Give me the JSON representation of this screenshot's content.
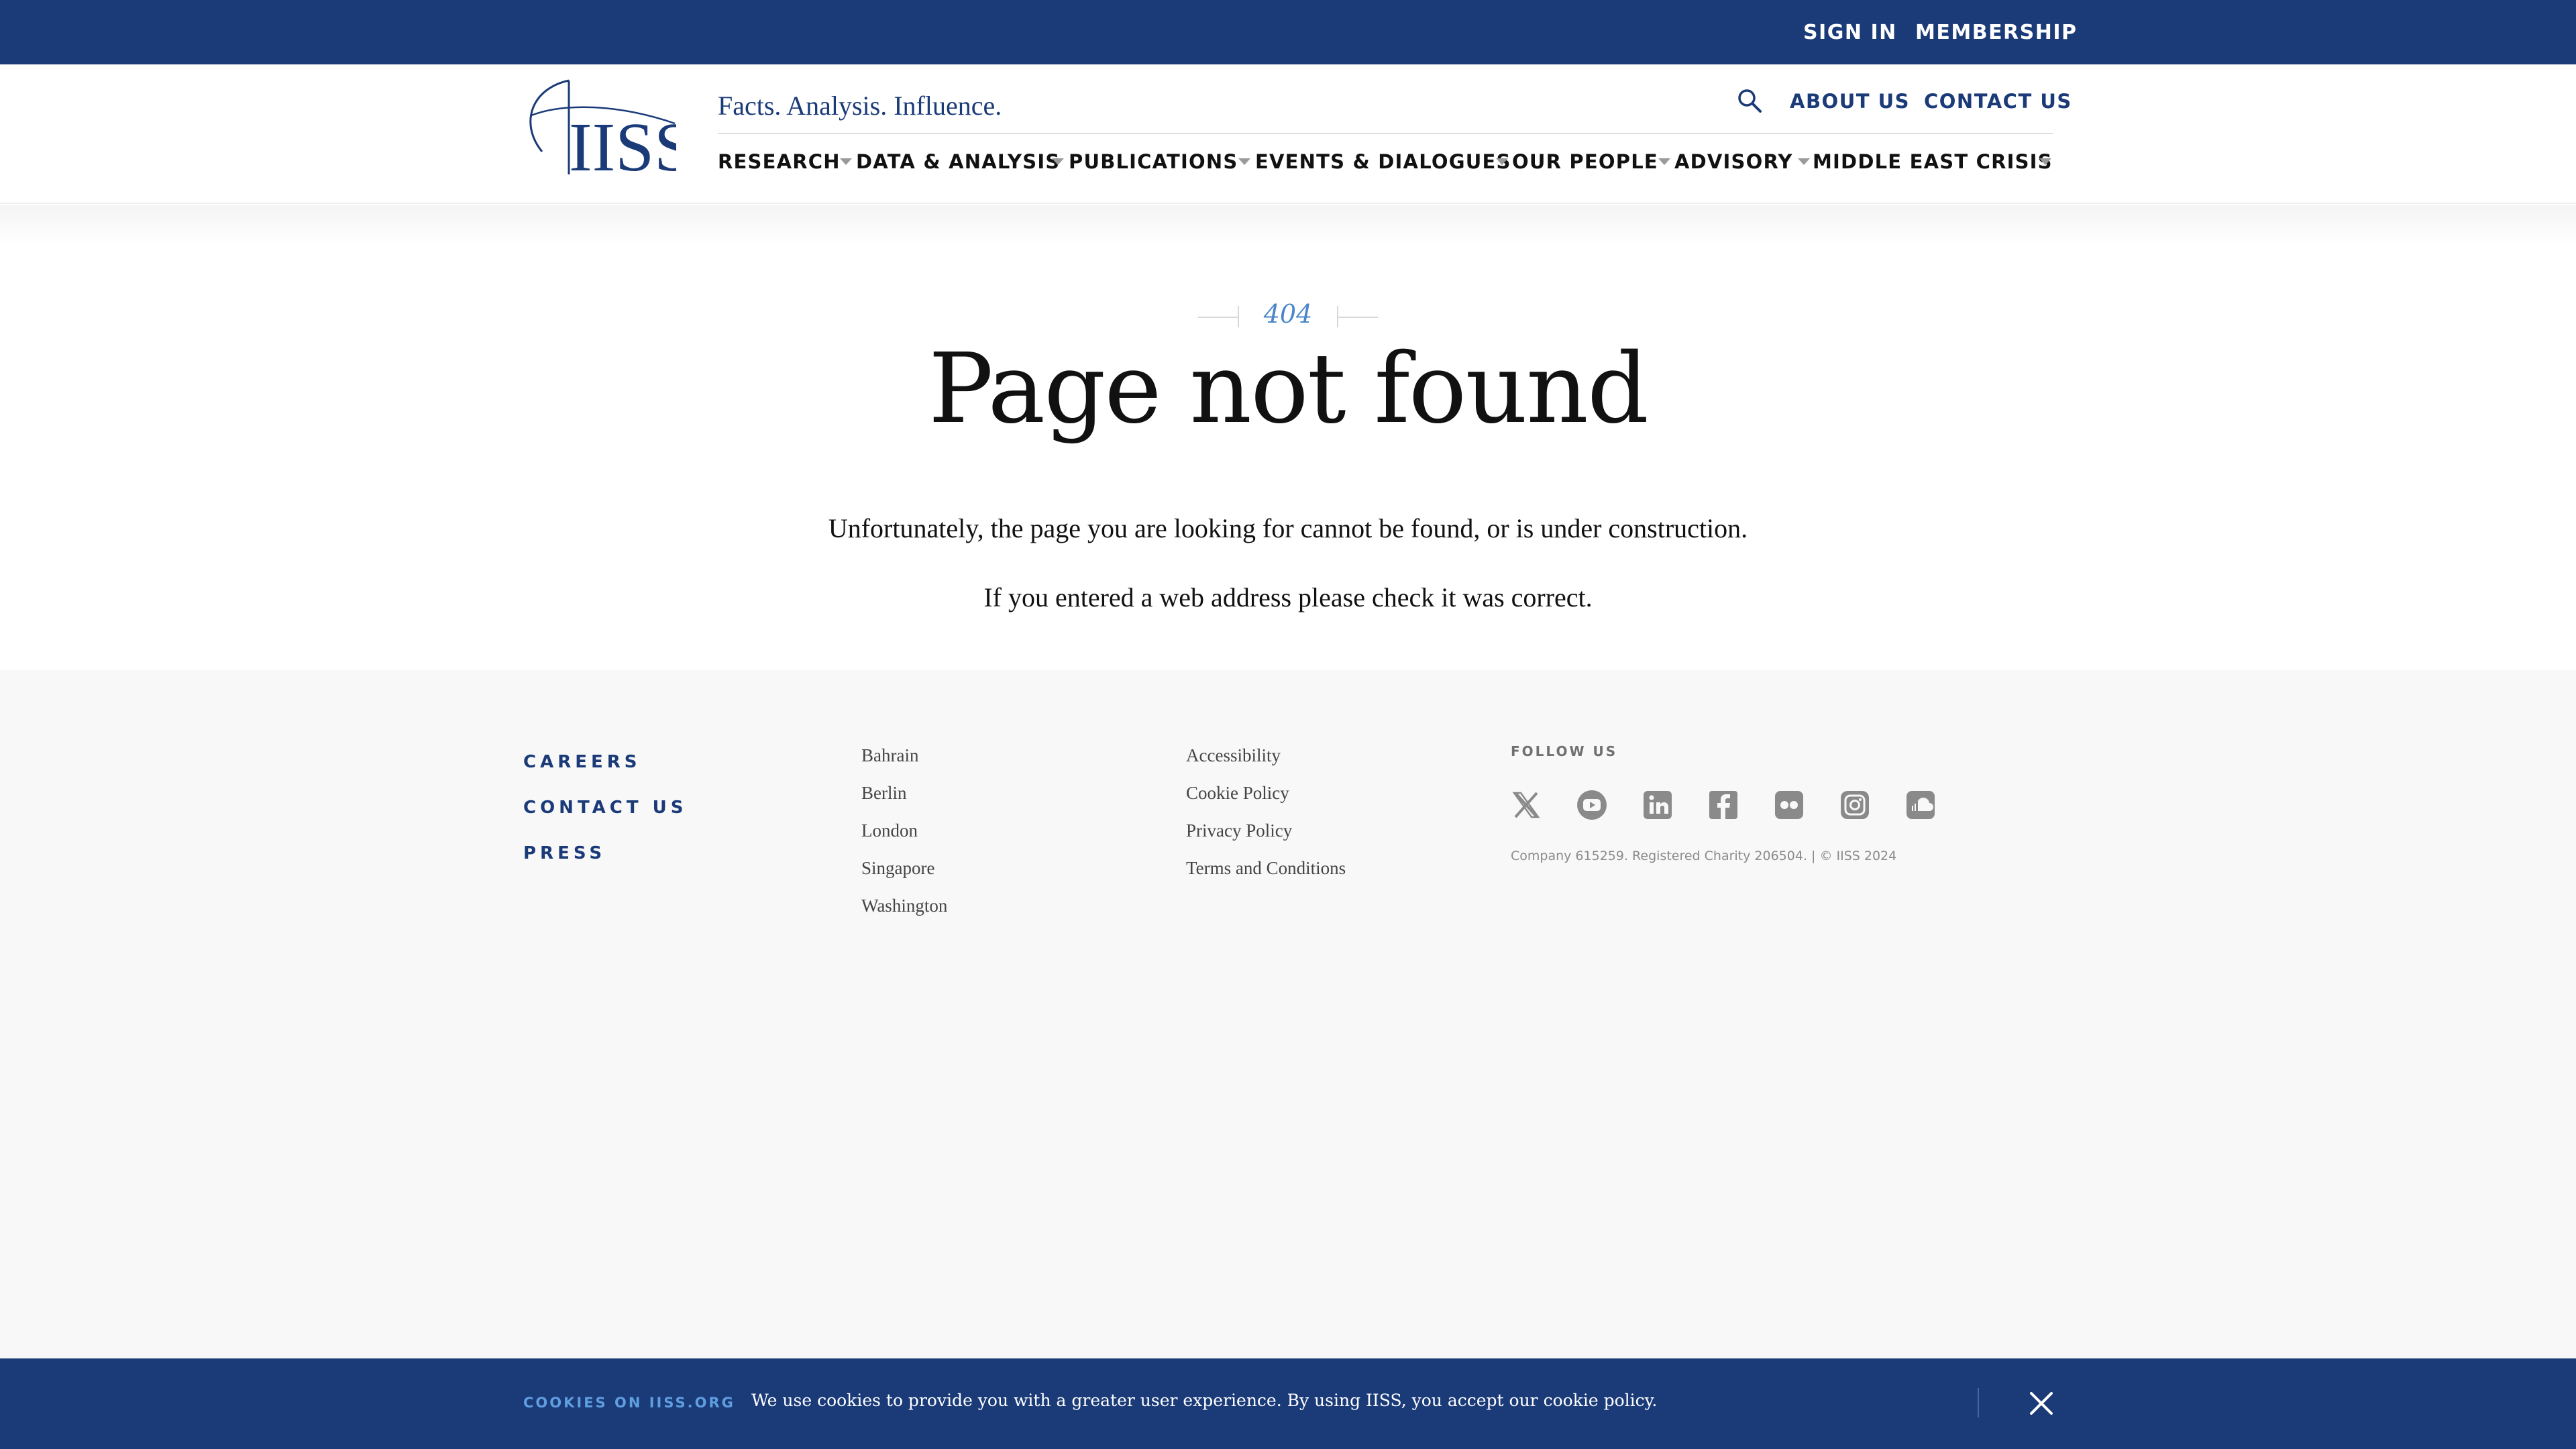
{
  "topbar": {
    "sign_in": "SIGN IN",
    "membership": "MEMBERSHIP"
  },
  "header": {
    "logo_text": "IISS",
    "tagline": "Facts. Analysis. Influence.",
    "about_us": "ABOUT US",
    "contact_us": "CONTACT US"
  },
  "nav": {
    "items": [
      {
        "label": "RESEARCH"
      },
      {
        "label": "DATA & ANALYSIS"
      },
      {
        "label": "PUBLICATIONS"
      },
      {
        "label": "EVENTS & DIALOGUES"
      },
      {
        "label": "OUR PEOPLE"
      },
      {
        "label": "ADVISORY"
      },
      {
        "label": "MIDDLE EAST CRISIS"
      }
    ]
  },
  "main": {
    "code": "404",
    "title": "Page not found",
    "message1": "Unfortunately, the page you are looking for cannot be found, or is under construction.",
    "message2": "If you entered a web address please check it was correct."
  },
  "footer": {
    "main_links": [
      "CAREERS",
      "CONTACT US",
      "PRESS"
    ],
    "offices": [
      "Bahrain",
      "Berlin",
      "London",
      "Singapore",
      "Washington"
    ],
    "policies": [
      "Accessibility",
      "Cookie Policy",
      "Privacy Policy",
      "Terms and Conditions"
    ],
    "follow_label": "FOLLOW US",
    "social_icons": [
      "x-icon",
      "youtube-icon",
      "linkedin-icon",
      "facebook-icon",
      "flickr-icon",
      "instagram-icon",
      "soundcloud-icon"
    ],
    "legal": "Company 615259. Registered Charity 206504.  |  © IISS 2024"
  },
  "cookie": {
    "label": "COOKIES ON IISS.ORG",
    "text": "We use cookies to provide you with a greater user experience. By using IISS, you accept our",
    "link": "cookie policy",
    "period": "."
  },
  "colors": {
    "brand_navy": "#1a3a78",
    "accent_blue": "#4a86c8",
    "footer_bg": "#f8f8f8"
  }
}
